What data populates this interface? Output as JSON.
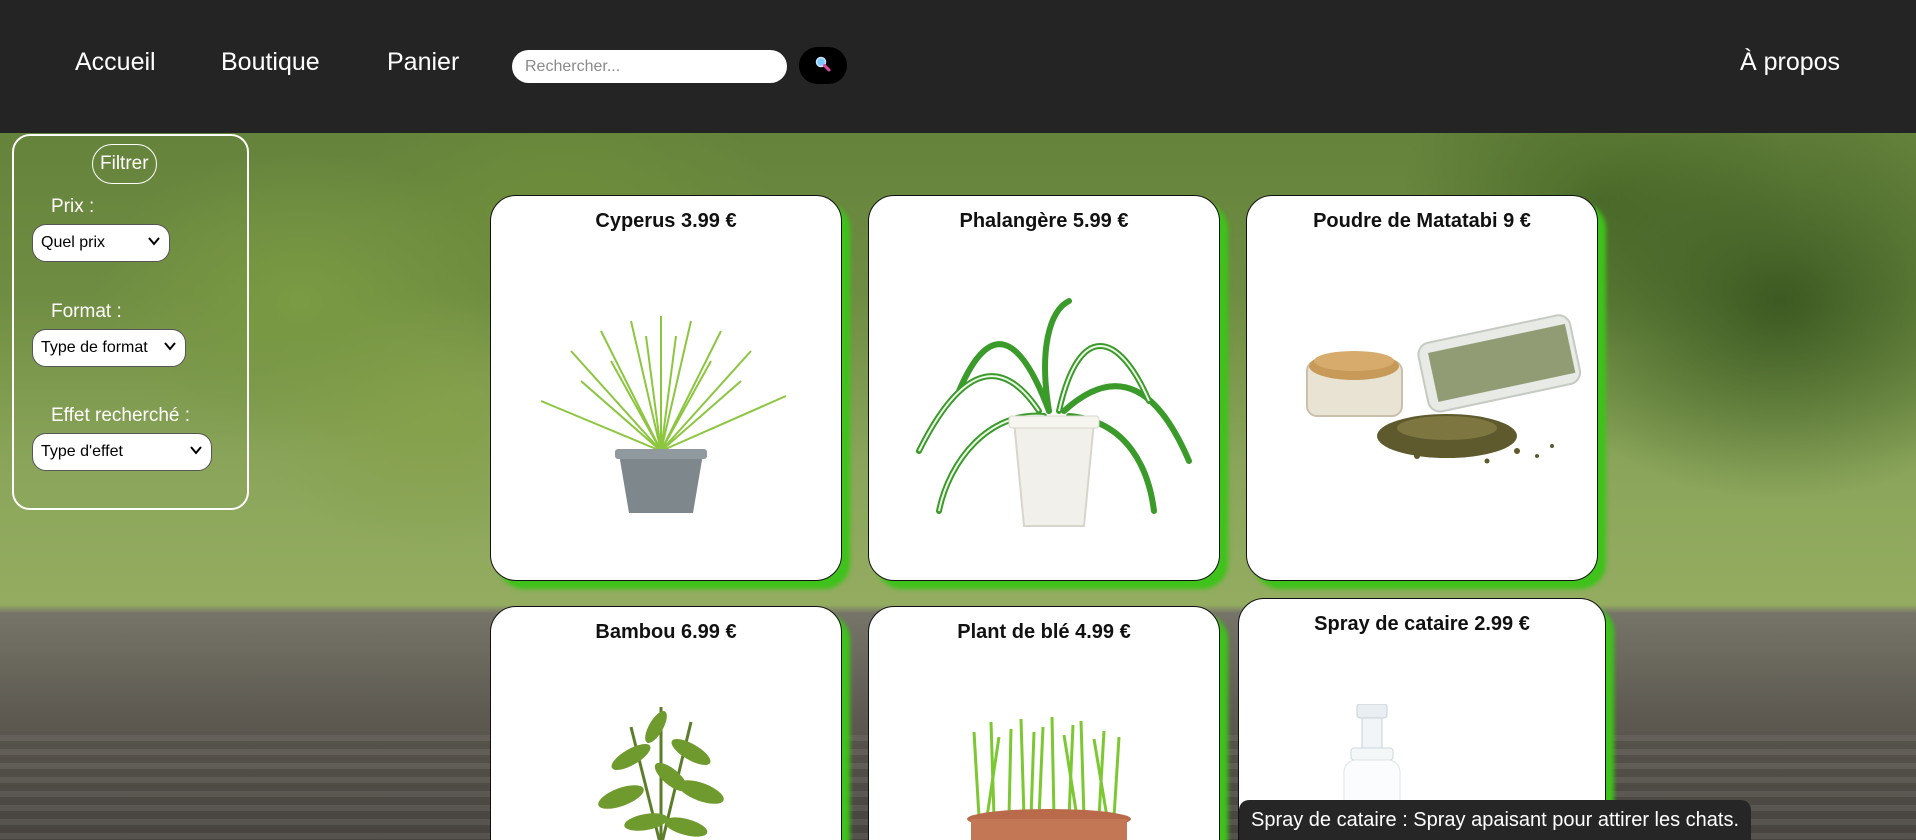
{
  "nav": {
    "home": "Accueil",
    "shop": "Boutique",
    "cart": "Panier",
    "about": "À propos"
  },
  "search": {
    "placeholder": "Rechercher...",
    "button_icon": "search-icon"
  },
  "filter": {
    "title": "Filtrer",
    "price_label": "Prix :",
    "price_value": "Quel prix",
    "format_label": "Format :",
    "format_value": "Type de format",
    "effect_label": "Effet recherché :",
    "effect_value": "Type d'effet"
  },
  "products": [
    {
      "title": "Cyperus 3.99 €"
    },
    {
      "title": "Phalangère 5.99 €"
    },
    {
      "title": "Poudre de Matatabi 9 €"
    },
    {
      "title": "Bambou 6.99 €"
    },
    {
      "title": "Plant de blé 4.99 €"
    },
    {
      "title": "Spray de cataire 2.99 €"
    }
  ],
  "tooltip": "Spray de cataire : Spray apaisant pour attirer les chats.",
  "colors": {
    "header_bg": "#242424",
    "card_shadow": "#3fc21b",
    "tooltip_bg": "#262626"
  }
}
